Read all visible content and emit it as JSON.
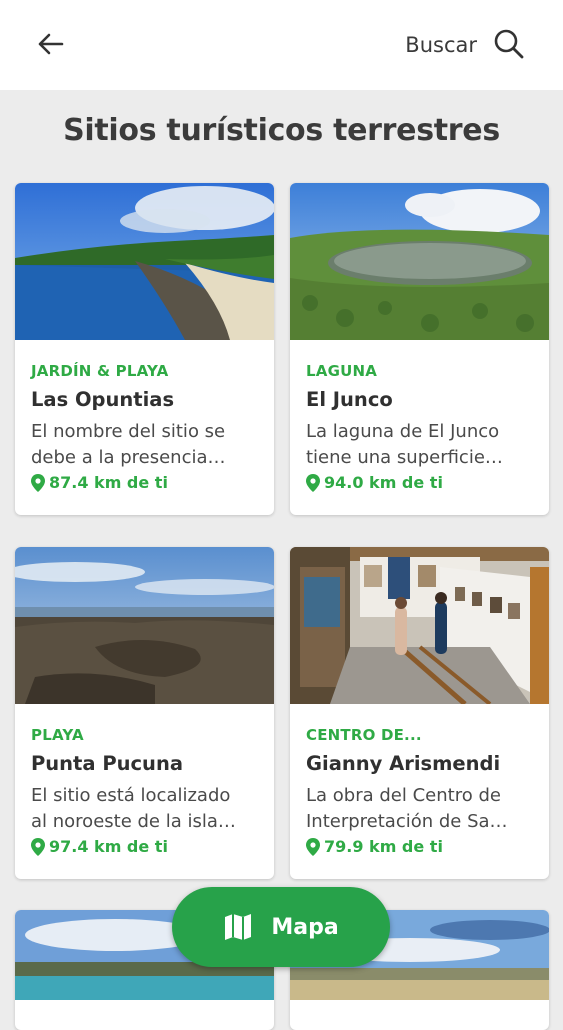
{
  "header": {
    "back_icon": "arrow-left-icon",
    "search_label": "Buscar",
    "search_icon": "magnifier-icon"
  },
  "page_title": "Sitios turísticos terrestres",
  "accent_color": "#2faa45",
  "cards": [
    {
      "category": "JARDÍN & PLAYA",
      "name": "Las Opuntias",
      "desc_line1": "El nombre del sitio se",
      "desc_line2": "debe a la presencia…",
      "distance": "87.4 km de ti"
    },
    {
      "category": "LAGUNA",
      "name": "El Junco",
      "desc_line1": "La laguna de El Junco",
      "desc_line2": "tiene una superficie…",
      "distance": "94.0 km de ti"
    },
    {
      "category": "PLAYA",
      "name": "Punta Pucuna",
      "desc_line1": "El sitio está localizado",
      "desc_line2": "al noroeste de la isla…",
      "distance": "97.4 km de ti"
    },
    {
      "category": "CENTRO DE...",
      "name": "Gianny Arismendi",
      "desc_line1": "La obra del Centro de",
      "desc_line2": "Interpretación de Sa…",
      "distance": "79.9 km de ti"
    }
  ],
  "map_button": {
    "label": "Mapa",
    "icon": "map-icon"
  }
}
